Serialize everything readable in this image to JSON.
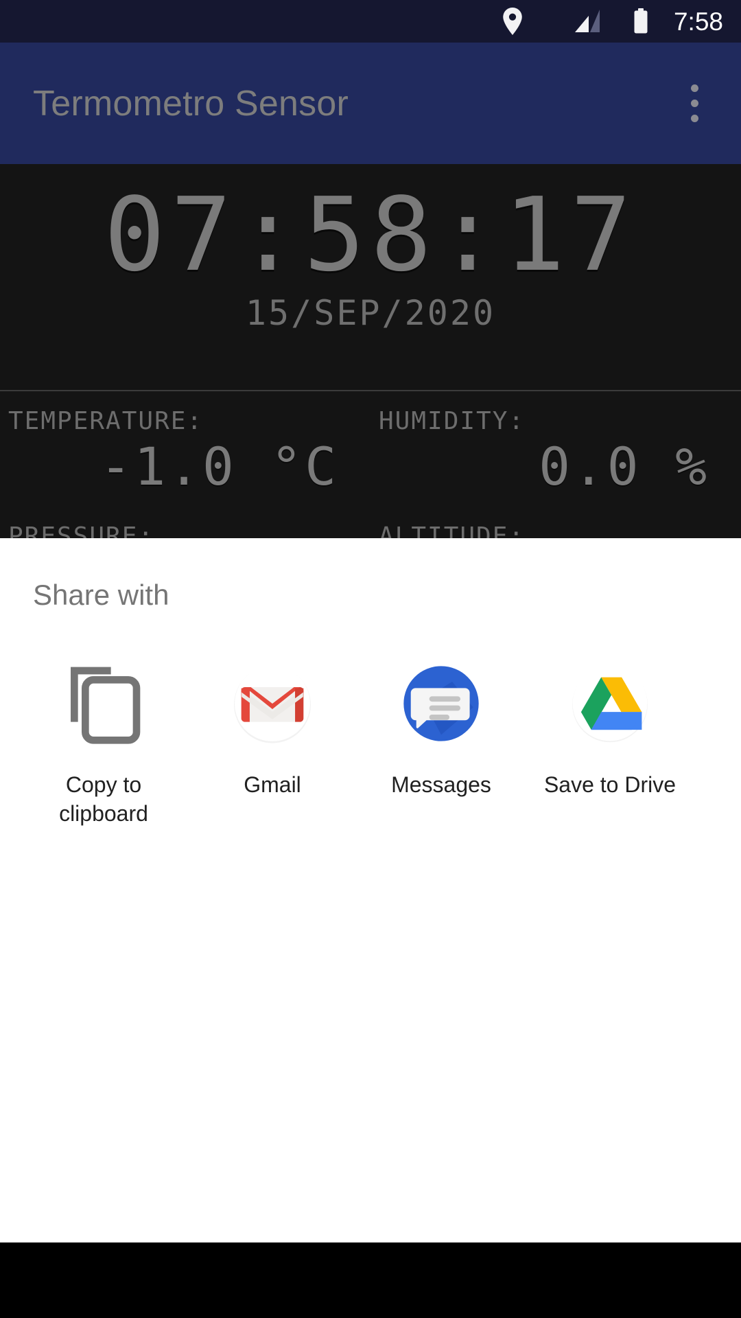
{
  "status_bar": {
    "time": "7:58",
    "icons": [
      "location-pin-icon",
      "signal-bars-icon",
      "battery-icon"
    ],
    "background_color": "#151730"
  },
  "app_bar": {
    "title": "Termometro Sensor",
    "overflow_label": "More options",
    "background_color": "#202a5d",
    "title_color": "#7d7d7d"
  },
  "lcd_panel": {
    "clock": "07:58:17",
    "date": "15/SEP/2020",
    "background_color": "#141414",
    "segment_color": "#7a7a7a",
    "readings": [
      {
        "label": "TEMPERATURE:",
        "value": "-1.0 °C"
      },
      {
        "label": "HUMIDITY:",
        "value": "0.0 %"
      },
      {
        "label": "PRESSURE:",
        "value": ""
      },
      {
        "label": "ALTITUDE:",
        "value": ""
      }
    ]
  },
  "share_sheet": {
    "title": "Share with",
    "targets": [
      {
        "label": "Copy to clipboard",
        "icon": "copy-to-clipboard-icon"
      },
      {
        "label": "Gmail",
        "icon": "gmail-icon"
      },
      {
        "label": "Messages",
        "icon": "messages-icon"
      },
      {
        "label": "Save to Drive",
        "icon": "google-drive-icon"
      }
    ]
  },
  "nav_bar": {
    "background_color": "#000000"
  }
}
